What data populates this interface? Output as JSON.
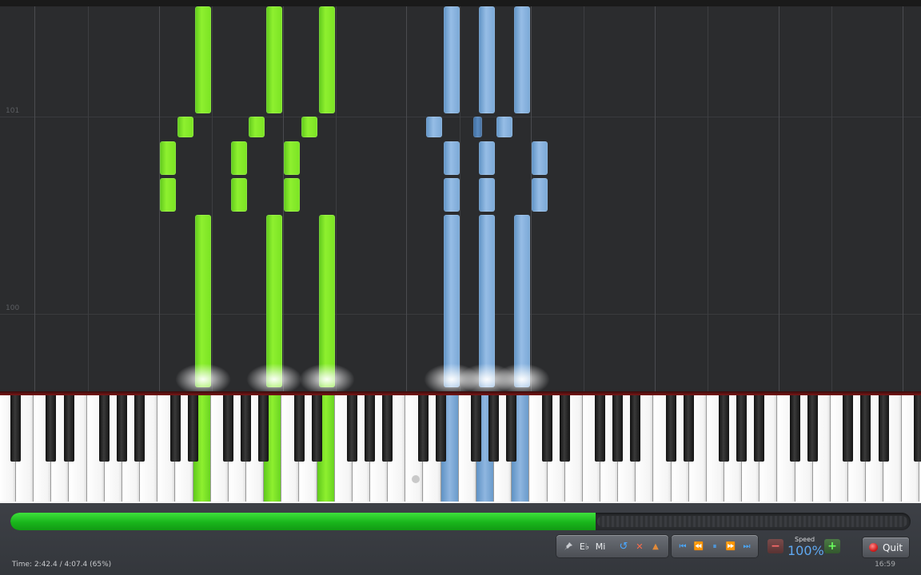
{
  "roll": {
    "measure_labels": [
      "101",
      "100"
    ]
  },
  "status": {
    "time_label": "Time:",
    "time_value": "2:42.4 / 4:07.4 (65%)",
    "progress": 0.65,
    "clock": "16:59"
  },
  "toolbar": {
    "tools": [
      {
        "name": "pin-icon",
        "label": ""
      },
      {
        "name": "key-signature-button",
        "label": "E♭"
      },
      {
        "name": "note-name-button",
        "label": "Mi"
      }
    ],
    "actions": [
      {
        "name": "loop-icon",
        "label": "↺",
        "color": "#4aa8ff"
      },
      {
        "name": "metronome-mute-icon",
        "label": "✕",
        "color": "#ff6a4a"
      },
      {
        "name": "metronome-icon",
        "label": "▲",
        "color": "#e08a3a"
      }
    ],
    "transport": [
      {
        "name": "skip-back-icon",
        "label": "⏮"
      },
      {
        "name": "rewind-icon",
        "label": "⏪"
      },
      {
        "name": "pause-icon",
        "label": "⏸"
      },
      {
        "name": "fast-forward-icon",
        "label": "⏩"
      },
      {
        "name": "skip-forward-icon",
        "label": "⏭"
      }
    ],
    "transport_color": "#4aa8ff"
  },
  "speed": {
    "label": "Speed",
    "value": "100%",
    "minus": "−",
    "plus": "+"
  },
  "quit": {
    "label": "Quit"
  },
  "colors": {
    "left_hand": "#7be324",
    "right_hand": "#8fb6e0",
    "progress": "#22c022"
  }
}
